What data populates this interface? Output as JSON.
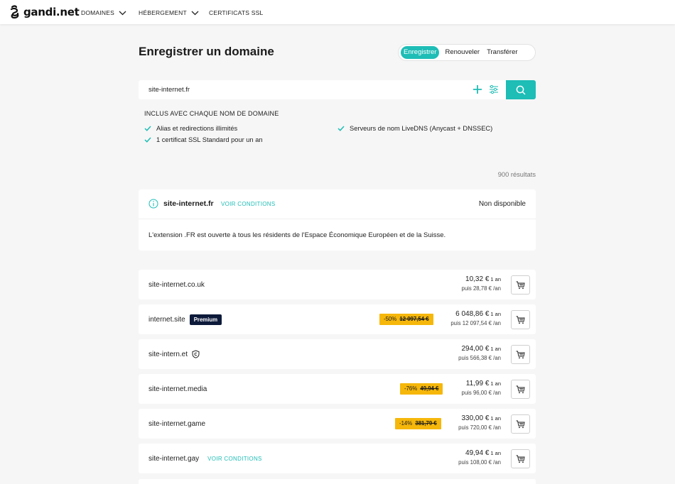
{
  "nav": {
    "logo_text": "gandi.net",
    "items": [
      {
        "label": "DOMAINES"
      },
      {
        "label": "HÉBERGEMENT"
      },
      {
        "label": "CERTIFICATS SSL"
      }
    ]
  },
  "page": {
    "title": "Enregistrer un domaine",
    "tabs": [
      "Enregistrer",
      "Renouveler",
      "Transférer"
    ],
    "active_tab": "Enregistrer"
  },
  "search": {
    "value": "site-internet.fr"
  },
  "includes": {
    "title": "INCLUS AVEC CHAQUE NOM DE DOMAINE",
    "features": [
      "Alias et redirections illimités",
      "1 certificat SSL Standard pour un an",
      "Serveurs de nom LiveDNS (Anycast + DNSSEC)"
    ]
  },
  "results_count": "900 résultats",
  "main_result": {
    "domain": "site-internet.fr",
    "conditions_link": "VOIR CONDITIONS",
    "status": "Non disponible",
    "note": "L'extension .FR est ouverte à tous les résidents de l'Espace Économique Européen et de la Suisse."
  },
  "rows": [
    {
      "domain": "site-internet.co.uk",
      "price": "10,32 €",
      "period": "1 an",
      "after": "puis 28,78 € /an"
    },
    {
      "domain": "internet.site",
      "badge": "Premium",
      "discount": "-50%",
      "old_price": "12 097,54 €",
      "price": "6 048,86 €",
      "period": "1 an",
      "after": "puis 12 097,54 € /an"
    },
    {
      "domain": "site-intern.et",
      "price": "294,00 €",
      "period": "1 an",
      "after": "puis 566,38 € /an"
    },
    {
      "domain": "site-internet.media",
      "discount": "-76%",
      "old_price": "49,94 €",
      "price": "11,99 €",
      "period": "1 an",
      "after": "puis 96,00 € /an"
    },
    {
      "domain": "site-internet.game",
      "discount": "-14%",
      "old_price": "381,79 €",
      "price": "330,00 €",
      "period": "1 an",
      "after": "puis 720,00 € /an"
    },
    {
      "domain": "site-internet.gay",
      "conditions_link": "VOIR CONDITIONS",
      "price": "49,94 €",
      "period": "1 an",
      "after": "puis 108,00 € /an"
    }
  ],
  "colors": {
    "accent": "#1ebdb6",
    "promo": "#f6b70b",
    "premium_badge": "#0d1a3a",
    "background": "#f6f6f6"
  }
}
